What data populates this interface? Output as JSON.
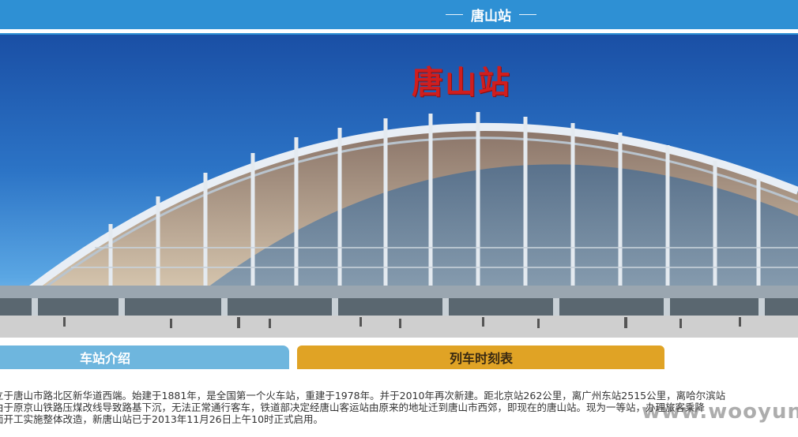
{
  "header": {
    "title": "唐山站"
  },
  "hero": {
    "sign_text": "唐山站"
  },
  "tabs": [
    {
      "label": "车站介绍"
    },
    {
      "label": "列车时刻表"
    }
  ],
  "content": {
    "lines": [
      "立于唐山市路北区新华道西端。始建于1881年，是全国第一个火车站，重建于1978年。并于2010年再次新建。距北京站262公里，离广州东站2515公里，离哈尔滨站",
      "由于原京山铁路压煤改线导致路基下沉，无法正常通行客车，铁道部决定经唐山客运站由原来的地址迁到唐山市西郊，即现在的唐山站。现为一等站，办理旅客乘降",
      "面开工实施整体改造，新唐山站已于2013年11月26日上午10时正式启用。"
    ]
  },
  "watermark": {
    "text": "www.wooyun.org"
  }
}
